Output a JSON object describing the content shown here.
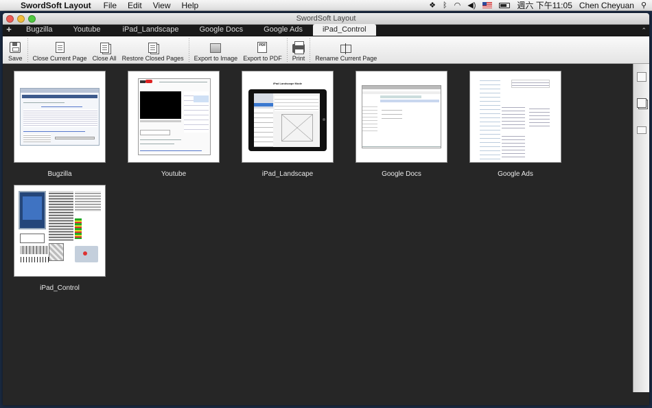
{
  "menubar": {
    "app_name": "SwordSoft Layout",
    "menus": [
      "File",
      "Edit",
      "View",
      "Help"
    ],
    "clock": "週六 下午11:05",
    "user": "Chen Cheyuan"
  },
  "window": {
    "title": "SwordSoft Layout"
  },
  "tabs": [
    {
      "label": "Bugzilla",
      "active": false
    },
    {
      "label": "Youtube",
      "active": false
    },
    {
      "label": "iPad_Landscape",
      "active": false
    },
    {
      "label": "Google Docs",
      "active": false
    },
    {
      "label": "Google Ads",
      "active": false
    },
    {
      "label": "iPad_Control",
      "active": true
    }
  ],
  "toolbar": {
    "save": "Save",
    "close_current": "Close Current Page",
    "close_all": "Close All",
    "restore_closed": "Restore Closed Pages",
    "export_image": "Export to Image",
    "export_pdf": "Export to PDF",
    "pdf_icon_text": "PDF",
    "print": "Print",
    "rename_current": "Rename Current Page"
  },
  "pages": [
    {
      "name": "Bugzilla"
    },
    {
      "name": "Youtube"
    },
    {
      "name": "iPad_Landscape"
    },
    {
      "name": "Google Docs"
    },
    {
      "name": "Google Ads"
    },
    {
      "name": "iPad_Control"
    }
  ],
  "thumb_text": {
    "ipad_landscape_title": "iPad Landscape Mode"
  }
}
